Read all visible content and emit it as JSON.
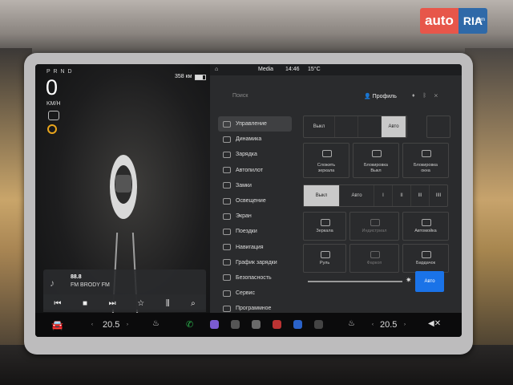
{
  "watermark": {
    "auto": "auto",
    "ria": "RIA",
    "com": ".com"
  },
  "left": {
    "gears": "P R N D",
    "speed": "0",
    "speed_unit": "KM/H",
    "range": "358 км"
  },
  "media": {
    "frequency": "88.8",
    "station": "FM BRODY FM",
    "controls": [
      "⏮",
      "■",
      "⏭",
      "☆",
      "⫼",
      "⌕"
    ]
  },
  "status_bar": {
    "label": "Media",
    "time": "14:46",
    "temp": "15°C"
  },
  "search": {
    "placeholder": "Поиск"
  },
  "profile": {
    "label": "Профиль"
  },
  "menu": [
    "Управление",
    "Динамика",
    "Зарядка",
    "Автопилот",
    "Замки",
    "Освещение",
    "Экран",
    "Поездки",
    "Навигация",
    "График зарядки",
    "Безопасность",
    "Сервис",
    "Программное"
  ],
  "lights": [
    "Выкл",
    "",
    "",
    "Авто",
    ""
  ],
  "cards_row1": [
    {
      "line1": "Сложить",
      "line2": "зеркала"
    },
    {
      "line1": "Блокировка",
      "line2": "Выкл"
    },
    {
      "line1": "Блокировка",
      "line2": "окна"
    }
  ],
  "wipers": [
    "Выкл",
    "Авто",
    "I",
    "II",
    "III",
    "IIII"
  ],
  "cards_grid": [
    {
      "label": "Зеркала",
      "dim": false
    },
    {
      "label": "Индистриал",
      "dim": true
    },
    {
      "label": "Автомойка",
      "dim": false
    },
    {
      "label": "Руль",
      "dim": false
    },
    {
      "label": "Фаркоп",
      "dim": true
    },
    {
      "label": "Бардачок",
      "dim": false
    }
  ],
  "auto_label": "Авто",
  "bottom": {
    "temp_left": "20.5",
    "temp_right": "20.5"
  }
}
